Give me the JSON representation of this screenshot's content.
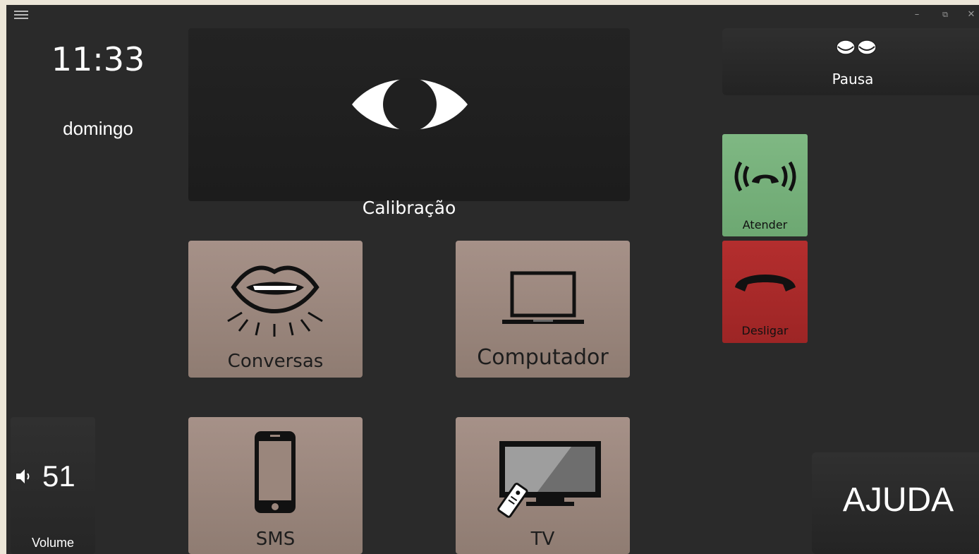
{
  "window": {
    "minimize_glyph": "–",
    "restore_glyph": "⧉",
    "close_glyph": "✕"
  },
  "status": {
    "time": "11:33",
    "day": "domingo"
  },
  "calibration": {
    "label": "Calibração",
    "icon": "eye-icon"
  },
  "tiles": {
    "conversas": {
      "label": "Conversas",
      "icon": "mouth-icon"
    },
    "computador": {
      "label": "Computador",
      "icon": "laptop-icon"
    },
    "sms": {
      "label": "SMS",
      "icon": "smartphone-icon"
    },
    "tv": {
      "label": "TV",
      "icon": "tv-icon"
    }
  },
  "pause": {
    "label": "Pausa",
    "icon": "closed-eyes-icon"
  },
  "call": {
    "answer_label": "Atender",
    "hangup_label": "Desligar",
    "answer_color": "#74ad78",
    "hangup_color": "#a82929"
  },
  "volume": {
    "value": "51",
    "label": "Volume",
    "icon": "speaker-icon"
  },
  "help": {
    "label": "AJUDA"
  },
  "colors": {
    "background": "#2a2a2a",
    "tile": "#9a867c",
    "panel": "#262626"
  }
}
